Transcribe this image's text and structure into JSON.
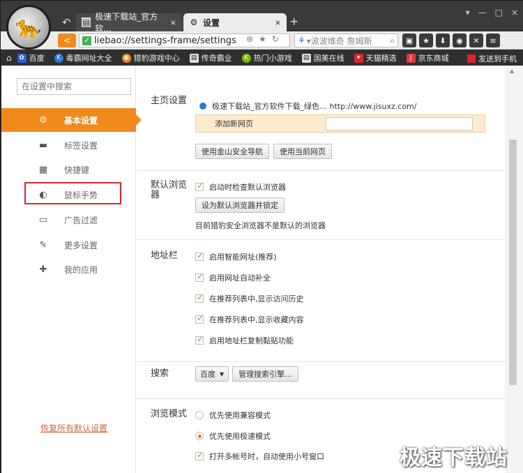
{
  "tabs": [
    {
      "label": "极速下载站_官方软...",
      "close": "×"
    },
    {
      "label": "设置",
      "close": "×"
    }
  ],
  "new_tab": "+",
  "window_controls": [
    "▾",
    "—",
    "□",
    "×"
  ],
  "address": {
    "back": "<",
    "url": "liebao://settings-frame/settings",
    "search_placeholder": "▾波波维奇 詹姆斯"
  },
  "bookmarks": [
    "百度",
    "毒霸网址大全",
    "猎豹游戏中心",
    "传奇霸业",
    "热门小游戏",
    "国美在线",
    "天猫精选",
    "京东商城"
  ],
  "send_to_phone": "发送到手机",
  "sidebar": {
    "search_placeholder": "在设置中搜索",
    "items": [
      {
        "label": "基本设置",
        "icon": "gear-icon"
      },
      {
        "label": "标签设置",
        "icon": "tab-icon"
      },
      {
        "label": "快捷键",
        "icon": "keyboard-icon"
      },
      {
        "label": "鼠标手势",
        "icon": "mouse-icon"
      },
      {
        "label": "广告过滤",
        "icon": "filter-icon"
      },
      {
        "label": "更多设置",
        "icon": "wrench-icon"
      },
      {
        "label": "我的应用",
        "icon": "puzzle-icon"
      }
    ],
    "active_index": 0,
    "restore_defaults": "恢复所有默认设置"
  },
  "homepage": {
    "title": "主页设置",
    "site_name": "极速下载站_官方软件下载_绿色...",
    "site_url": "http://www.jisuxz.com/",
    "add_label": "添加新网页",
    "btn_safe_nav": "使用金山安全导航",
    "btn_current": "使用当前网页"
  },
  "default_browser": {
    "title": "默认浏览器",
    "check_on_start": "启动时检查默认浏览器",
    "set_default_btn": "设为默认浏览器并锁定",
    "status": "目前猎豹安全浏览器不是默认的浏览器"
  },
  "address_bar": {
    "title": "地址栏",
    "options": [
      "启用智能网址(推荐)",
      "启用网址自动补全",
      "在推荐列表中,显示访问历史",
      "在推荐列表中,显示收藏内容",
      "启用地址栏复制黏贴功能"
    ]
  },
  "search": {
    "title": "搜索",
    "engine": "百度",
    "manage_btn": "管理搜索引擎..."
  },
  "browse_mode": {
    "title": "浏览模式",
    "opt_compat": "优先使用兼容模式",
    "opt_fast": "优先使用极速模式",
    "opt_multi": "打开多帐号时，自动使用小号窗口"
  },
  "watermark": "极速下载站",
  "colors": {
    "accent": "#f08a1c",
    "highlight_box": "#d9262b"
  }
}
